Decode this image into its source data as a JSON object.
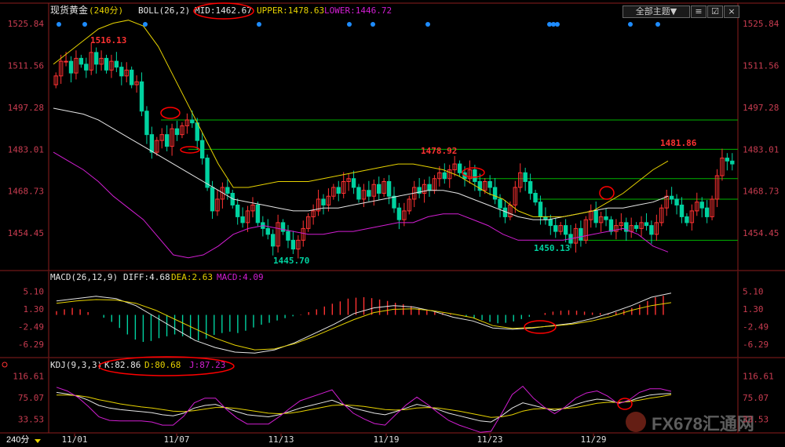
{
  "header": {
    "title": "现货黄金",
    "period": "(240分)",
    "boll_label": "BOLL(26,2)",
    "mid": "MID:1462.67",
    "upper": "UPPER:1478.63",
    "lower": "LOWER:1446.72",
    "dropdown_label": "全部主题▼",
    "sub_label": "≡",
    "checkbox_label": "☑",
    "close_label": "×"
  },
  "period_badge": "240分",
  "macd_header": {
    "label": "MACD(26,12,9)",
    "diff": "DIFF:4.68",
    "dea": "DEA:2.63",
    "macd": "MACD:4.09"
  },
  "kdj_header": {
    "label": "KDJ(9,3,3)",
    "k": "K:82.86",
    "d": "D:80.68",
    "j": "J:87.23"
  },
  "watermark": "FX678汇通网",
  "colors": {
    "up": "#ff3232",
    "down": "#00d2a0",
    "mid": "#e6e6e6",
    "upper": "#e6d200",
    "lower": "#d21ed2",
    "hline": "#00b400",
    "circle": "#ff0000",
    "axis": "#c83c50"
  },
  "chart_data": [
    {
      "type": "candlestick",
      "title": "现货黄金(240分) BOLL(26,2)",
      "x": [
        "11/01",
        "11/07",
        "11/13",
        "11/19",
        "11/23",
        "11/29"
      ],
      "ylim": [
        1443,
        1528
      ],
      "y_ticks": [
        1525.84,
        1511.56,
        1497.28,
        1483.01,
        1468.73,
        1454.45
      ],
      "annotations": [
        {
          "text": "1516.13",
          "type": "high"
        },
        {
          "text": "1445.70",
          "type": "low"
        },
        {
          "text": "1478.92",
          "type": "high"
        },
        {
          "text": "1450.13",
          "type": "low"
        },
        {
          "text": "1481.86",
          "type": "high"
        }
      ],
      "horizontal_levels": [
        1493,
        1483,
        1473,
        1466,
        1452
      ],
      "close": [
        1508,
        1513,
        1513,
        1509,
        1514,
        1512,
        1510,
        1516,
        1512,
        1514,
        1510,
        1513,
        1511,
        1508,
        1510,
        1505,
        1506,
        1496,
        1488,
        1482,
        1486,
        1488,
        1484,
        1490,
        1488,
        1491,
        1493,
        1492,
        1486,
        1480,
        1470,
        1462,
        1466,
        1470,
        1468,
        1464,
        1460,
        1458,
        1462,
        1464,
        1458,
        1456,
        1454,
        1450,
        1458,
        1455,
        1452,
        1449,
        1452,
        1456,
        1460,
        1462,
        1466,
        1464,
        1467,
        1470,
        1468,
        1472,
        1473,
        1470,
        1466,
        1469,
        1467,
        1471,
        1468,
        1472,
        1467,
        1463,
        1459,
        1462,
        1466,
        1470,
        1468,
        1471,
        1469,
        1473,
        1475,
        1473,
        1476,
        1478,
        1475,
        1473,
        1476,
        1472,
        1469,
        1472,
        1470,
        1466,
        1463,
        1460,
        1464,
        1470,
        1475,
        1472,
        1468,
        1465,
        1460,
        1459,
        1457,
        1455,
        1457,
        1454,
        1451,
        1456,
        1452,
        1459,
        1462,
        1458,
        1460,
        1459,
        1455,
        1457,
        1458,
        1455,
        1457,
        1456,
        1458,
        1457,
        1454,
        1458,
        1463,
        1467,
        1466,
        1464,
        1460,
        1458,
        1462,
        1465,
        1463,
        1460,
        1466,
        1474,
        1480,
        1479,
        1478
      ],
      "series": [
        {
          "name": "MID",
          "values": [
            1497,
            1496,
            1495,
            1493,
            1490,
            1487,
            1484,
            1481,
            1478,
            1475,
            1472,
            1469,
            1466,
            1465,
            1464,
            1463,
            1462,
            1462,
            1463,
            1463,
            1464,
            1465,
            1466,
            1467,
            1468,
            1469,
            1469,
            1468,
            1466,
            1464,
            1462,
            1460,
            1459,
            1459,
            1460,
            1461,
            1462,
            1463,
            1463,
            1464,
            1465,
            1467
          ]
        },
        {
          "name": "UPPER",
          "values": [
            1512,
            1516,
            1520,
            1524,
            1526,
            1527,
            1525,
            1518,
            1508,
            1498,
            1488,
            1478,
            1470,
            1470,
            1471,
            1472,
            1472,
            1472,
            1473,
            1474,
            1475,
            1476,
            1477,
            1478,
            1478,
            1477,
            1476,
            1474,
            1471,
            1468,
            1466,
            1462,
            1460,
            1460,
            1460,
            1461,
            1462,
            1465,
            1468,
            1472,
            1476,
            1479
          ]
        },
        {
          "name": "LOWER",
          "values": [
            1482,
            1479,
            1476,
            1472,
            1467,
            1463,
            1459,
            1453,
            1447,
            1446,
            1447,
            1450,
            1454,
            1456,
            1457,
            1456,
            1455,
            1454,
            1454,
            1455,
            1455,
            1456,
            1457,
            1458,
            1458,
            1460,
            1461,
            1461,
            1459,
            1457,
            1454,
            1452,
            1452,
            1452,
            1452,
            1453,
            1454,
            1455,
            1456,
            1454,
            1450,
            1448
          ]
        }
      ]
    },
    {
      "type": "bar",
      "title": "MACD(26,12,9)",
      "ylim": [
        -8.5,
        7
      ],
      "y_ticks": [
        5.1,
        1.3,
        -2.49,
        -6.29
      ],
      "values": [
        0.8,
        1.2,
        1.5,
        1.2,
        0.6,
        0,
        -0.6,
        -1.5,
        -2.8,
        -4.2,
        -5.3,
        -5.8,
        -5.6,
        -5.0,
        -4.6,
        -4.2,
        -4.6,
        -5.1,
        -5.5,
        -5.1,
        -4.3,
        -3.9,
        -3.6,
        -3.9,
        -3.4,
        -2.7,
        -2.1,
        -1.7,
        -1.2,
        -0.7,
        -0.3,
        0.1,
        0.6,
        1.2,
        1.8,
        2.4,
        2.9,
        3.5,
        3.7,
        3.8,
        3.6,
        3.3,
        3.0,
        2.6,
        2.3,
        1.9,
        1.5,
        1.0,
        0.6,
        0.4,
        0.2,
        0,
        -0.3,
        -0.7,
        -1.1,
        -1.5,
        -1.8,
        -1.7,
        -1.4,
        -0.9,
        -0.4,
        0,
        0.4,
        0.7,
        0.9,
        1.0,
        0.9,
        0.7,
        0.5,
        0.4,
        0.3,
        0.6,
        1.0,
        1.5,
        2.2,
        3.0,
        3.8,
        4.1
      ],
      "series": [
        {
          "name": "DIFF",
          "values": [
            3,
            3.5,
            4,
            3.5,
            2,
            -0.5,
            -3,
            -5.5,
            -7,
            -8,
            -8.2,
            -7.5,
            -6,
            -4,
            -2,
            0.3,
            1.5,
            2,
            1.7,
            0.8,
            -0.5,
            -1.3,
            -2.8,
            -3.1,
            -2.8,
            -2.3,
            -1.8,
            -0.8,
            0.5,
            2,
            3.8,
            4.68
          ]
        },
        {
          "name": "DEA",
          "values": [
            2.5,
            3,
            3.3,
            3.2,
            2.5,
            1,
            -1,
            -3,
            -5,
            -6.5,
            -7.5,
            -7.3,
            -6.2,
            -4.6,
            -2.8,
            -1,
            0.5,
            1.2,
            1.3,
            0.9,
            0.2,
            -0.6,
            -2.3,
            -2.9,
            -2.7,
            -2.4,
            -2,
            -1.3,
            -0.3,
            1,
            2,
            2.63
          ]
        }
      ]
    },
    {
      "type": "line",
      "title": "KDJ(9,3,3)",
      "ylim": [
        10,
        125
      ],
      "y_ticks": [
        116.61,
        75.07,
        33.53
      ],
      "series": [
        {
          "name": "K",
          "values": [
            85,
            82,
            78,
            70,
            60,
            55,
            52,
            50,
            48,
            46,
            42,
            40,
            45,
            55,
            60,
            62,
            55,
            48,
            42,
            40,
            38,
            42,
            48,
            55,
            60,
            65,
            70,
            62,
            55,
            50,
            45,
            42,
            48,
            55,
            62,
            58,
            52,
            45,
            40,
            35,
            30,
            28,
            40,
            55,
            65,
            60,
            55,
            50,
            55,
            62,
            68,
            72,
            70,
            65,
            68,
            75,
            80,
            82,
            82.86
          ]
        },
        {
          "name": "D",
          "values": [
            80,
            80,
            79,
            76,
            71,
            67,
            63,
            60,
            57,
            55,
            52,
            49,
            48,
            50,
            53,
            56,
            56,
            54,
            51,
            48,
            45,
            44,
            45,
            48,
            52,
            56,
            60,
            61,
            60,
            58,
            55,
            52,
            51,
            52,
            55,
            56,
            55,
            52,
            49,
            45,
            41,
            37,
            38,
            42,
            49,
            53,
            54,
            53,
            54,
            56,
            60,
            64,
            66,
            66,
            67,
            70,
            74,
            77,
            80.68
          ]
        },
        {
          "name": "J",
          "values": [
            95,
            88,
            76,
            58,
            38,
            31,
            30,
            30,
            30,
            28,
            22,
            22,
            39,
            65,
            74,
            74,
            53,
            36,
            24,
            24,
            24,
            38,
            54,
            69,
            76,
            83,
            90,
            64,
            45,
            34,
            25,
            22,
            42,
            61,
            76,
            62,
            46,
            31,
            22,
            15,
            8,
            10,
            44,
            81,
            97,
            74,
            57,
            44,
            57,
            74,
            84,
            88,
            78,
            63,
            70,
            85,
            92,
            92,
            87.23
          ]
        }
      ]
    }
  ],
  "x_labels": [
    "11/01",
    "11/07",
    "11/13",
    "11/19",
    "11/23",
    "11/29"
  ]
}
